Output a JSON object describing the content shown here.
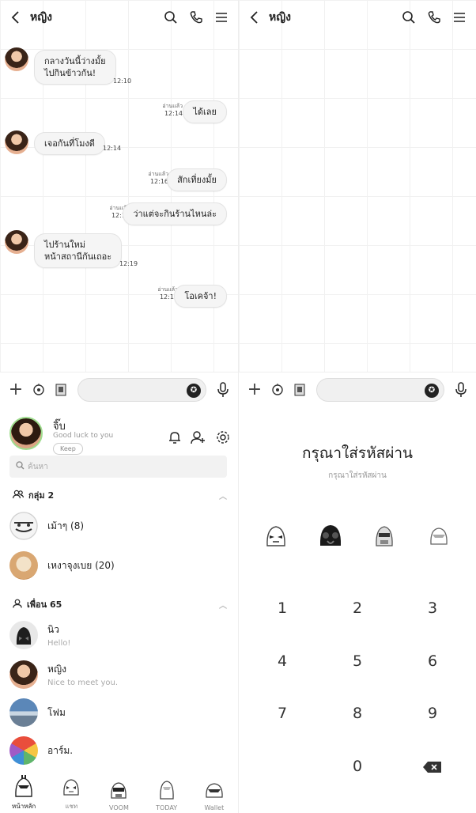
{
  "chat": {
    "title": "หญิง",
    "messages": [
      {
        "dir": "in",
        "lines": [
          "กลางวันนี้ว่างมั้ย",
          "ไปกินข้าวกัน!"
        ],
        "time": "12:10"
      },
      {
        "dir": "out",
        "lines": [
          "ได้เลย"
        ],
        "read": "อ่านแล้ว",
        "time": "12:14"
      },
      {
        "dir": "in",
        "lines": [
          "เจอกันที่โมงดี"
        ],
        "time": "12:14"
      },
      {
        "dir": "out",
        "lines": [
          "สักเที่ยงมั้ย"
        ],
        "read": "อ่านแล้ว",
        "time": "12:16"
      },
      {
        "dir": "out",
        "lines": [
          "ว่าแต่จะกินร้านไหนล่ะ"
        ],
        "read": "อ่านแล้ว",
        "time": "12:16"
      },
      {
        "dir": "in",
        "lines": [
          "ไปร้านใหม่",
          "หน้าสถานีกันเถอะ"
        ],
        "time": "12:19"
      },
      {
        "dir": "out",
        "lines": [
          "โอเคจ้า!"
        ],
        "read": "อ่านแล้ว",
        "time": "12:19"
      }
    ]
  },
  "profile": {
    "name": "จิ๊บ",
    "status": "Good luck to you",
    "keep": "Keep"
  },
  "search": {
    "placeholder": "ค้นหา"
  },
  "groups": {
    "header": "กลุ่ม 2",
    "items": [
      {
        "name": "เม้าๆ (8)"
      },
      {
        "name": "เหงาจุงเบย (20)"
      }
    ]
  },
  "friends": {
    "header": "เพื่อน 65",
    "items": [
      {
        "name": "นิว",
        "sub": "Hello!"
      },
      {
        "name": "หญิง",
        "sub": "Nice to meet you."
      },
      {
        "name": "โฟม",
        "sub": ""
      },
      {
        "name": "อาร์ม.",
        "sub": ""
      }
    ]
  },
  "tabs": [
    {
      "label": "หน้าหลัก",
      "icon": "clone-trooper-icon"
    },
    {
      "label": "แชท",
      "icon": "stormtrooper-icon"
    },
    {
      "label": "VOOM",
      "icon": "scout-trooper-icon"
    },
    {
      "label": "TODAY",
      "icon": "purge-trooper-icon"
    },
    {
      "label": "Wallet",
      "icon": "stormtrooper-helmet-icon"
    }
  ],
  "passcode": {
    "title": "กรุณาใส่รหัสผ่าน",
    "subtitle": "กรุณาใส่รหัสผ่าน",
    "keys": [
      "1",
      "2",
      "3",
      "4",
      "5",
      "6",
      "7",
      "8",
      "9",
      "0"
    ]
  }
}
